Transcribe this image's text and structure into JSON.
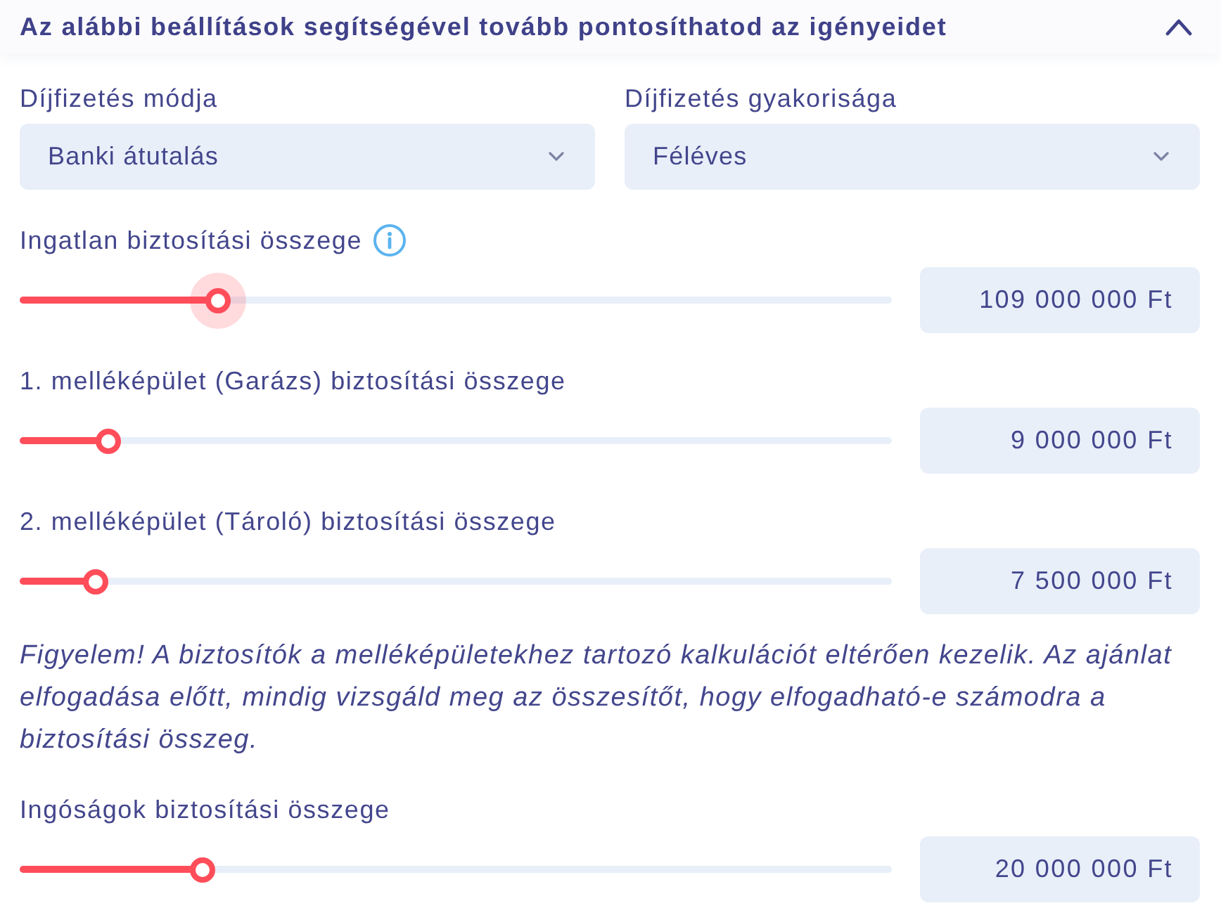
{
  "section": {
    "title": "Az alábbi beállítások segítségével tovább pontosíthatod az igényeidet",
    "expanded": true
  },
  "selects": [
    {
      "label": "Díjfizetés módja",
      "value": "Banki átutalás"
    },
    {
      "label": "Díjfizetés gyakorisága",
      "value": "Féléves"
    }
  ],
  "items": [
    {
      "kind": "slider",
      "label": "Ingatlan biztosítási összege",
      "info": true,
      "level": 0.227,
      "focused": true,
      "value": "109 000 000 Ft"
    },
    {
      "kind": "slider",
      "label": "1. melléképület (Garázs) biztosítási összege",
      "info": false,
      "level": 0.102,
      "focused": false,
      "value": "9 000 000 Ft"
    },
    {
      "kind": "slider",
      "label": "2. melléképület (Tároló) biztosítási összege",
      "info": false,
      "level": 0.087,
      "focused": false,
      "value": "7 500 000 Ft"
    },
    {
      "kind": "notice",
      "text": "Figyelem! A biztosítók a melléképületekhez tartozó kalkulációt eltérően kezelik. Az ajánlat elfogadása előtt, mindig vizsgáld meg az összesítőt, hogy elfogadható-e számodra a biztosítási összeg."
    },
    {
      "kind": "slider",
      "label": "Ingóságok biztosítási összege",
      "info": false,
      "level": 0.21,
      "focused": false,
      "value": "20 000 000 Ft"
    }
  ]
}
